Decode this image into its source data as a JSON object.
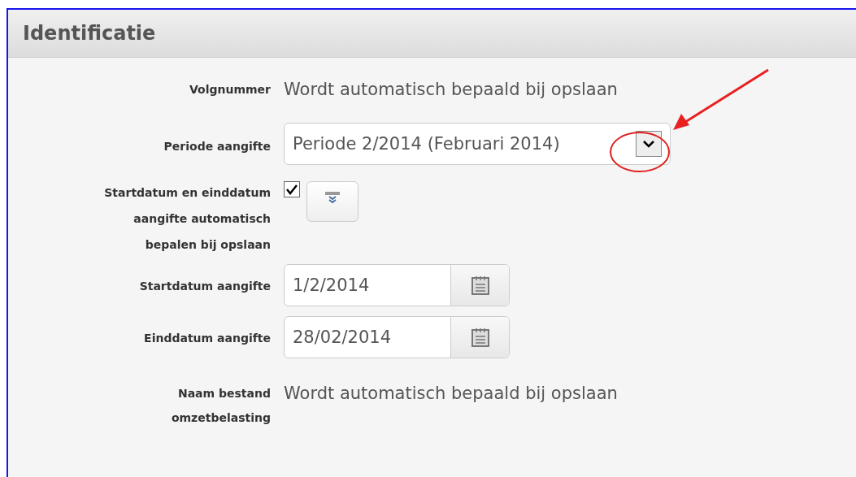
{
  "panel": {
    "title": "Identificatie"
  },
  "rows": [
    {
      "kind": "text",
      "label": "Volgnummer",
      "value": "Wordt automatisch bepaald bij opslaan"
    },
    {
      "kind": "select",
      "label": "Periode aangifte",
      "value": "Periode 2/2014 (Februari 2014)"
    },
    {
      "kind": "checkbox",
      "label": "Startdatum en einddatum aangifte automatisch bepalen bij opslaan",
      "checked": true
    },
    {
      "kind": "date",
      "label": "Startdatum aangifte",
      "value": "1/2/2014"
    },
    {
      "kind": "date",
      "label": "Einddatum aangifte",
      "value": "28/02/2014"
    },
    {
      "kind": "text",
      "label": "Naam bestand omzetbelasting",
      "value": "Wordt automatisch bepaald bij opslaan"
    }
  ]
}
